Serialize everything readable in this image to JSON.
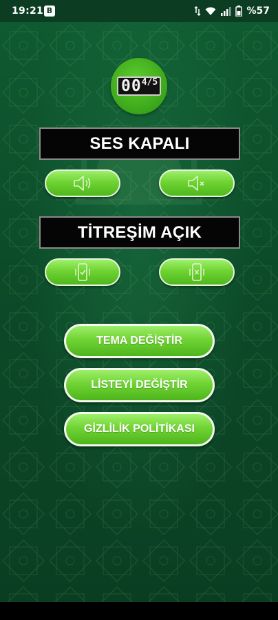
{
  "status_bar": {
    "time": "19:21",
    "app_badge": "B",
    "battery_text": "%57"
  },
  "counter": {
    "digits": "00",
    "last_digit": "4/5"
  },
  "sound": {
    "label": "SES KAPALI",
    "on_icon": "speaker-on-icon",
    "off_icon": "speaker-muted-icon"
  },
  "vibration": {
    "label": "TİTREŞİM AÇIK",
    "on_icon": "phone-vibrate-check-icon",
    "off_icon": "phone-vibrate-off-icon"
  },
  "menu": {
    "theme_label": "TEMA DEĞİŞTİR",
    "list_label": "LİSTEYİ DEĞİŞTİR",
    "privacy_label": "GİZLİLİK POLİTİKASI"
  },
  "colors": {
    "background": "#0c4a28",
    "button_green": "#6fd333",
    "counter_green": "#3aa51a",
    "panel_black": "#050505"
  }
}
